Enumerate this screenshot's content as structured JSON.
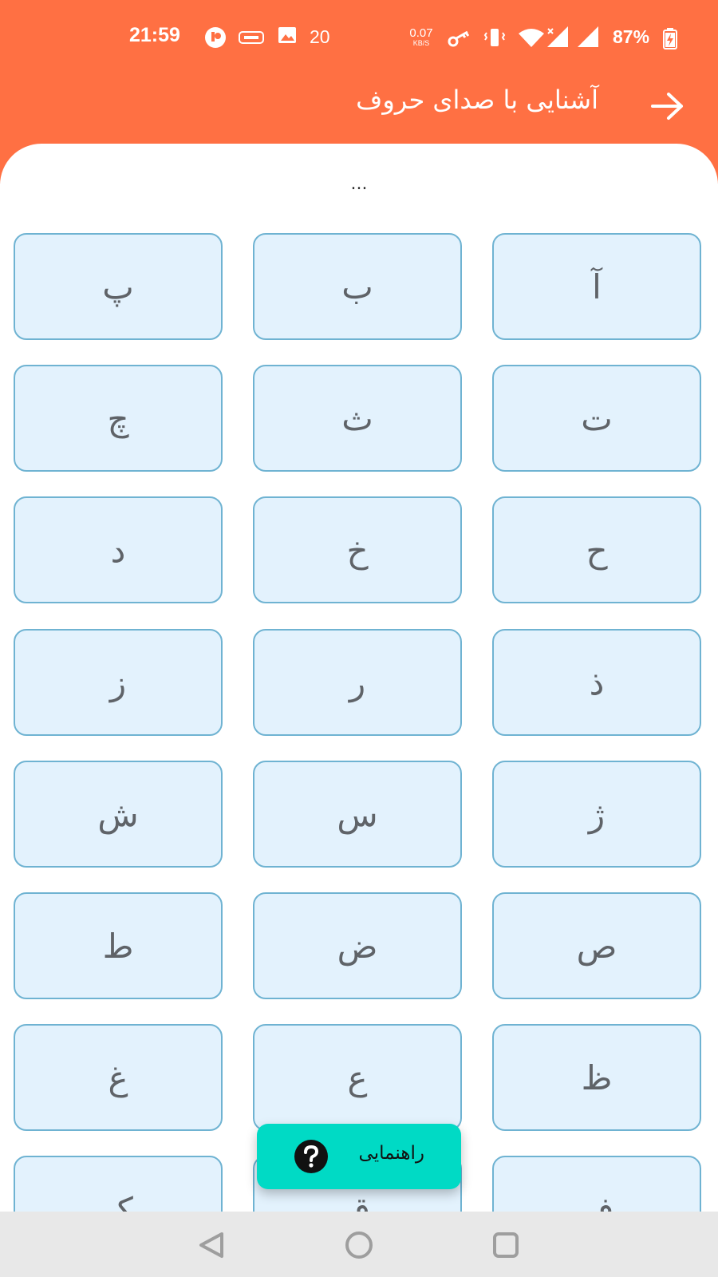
{
  "status_bar": {
    "time": "21:59",
    "notification_count": "20",
    "net_speed_value": "0.07",
    "net_speed_unit": "KB/S",
    "battery": "87%",
    "icons": [
      "circle-app-icon",
      "vpn-pill-icon",
      "image-icon",
      "key-icon",
      "vibrate-icon",
      "wifi-icon",
      "signal-no-data-icon",
      "signal-icon",
      "battery-charging-icon"
    ]
  },
  "header": {
    "title": "آشنایی با صدای حروف",
    "back_icon": "arrow-right-icon"
  },
  "status_message": "...",
  "letters": [
    "آ",
    "ب",
    "پ",
    "ت",
    "ث",
    "چ",
    "ح",
    "خ",
    "د",
    "ذ",
    "ر",
    "ز",
    "ژ",
    "س",
    "ش",
    "ص",
    "ض",
    "ط",
    "ظ",
    "ع",
    "غ",
    "ف",
    "ق",
    "ک"
  ],
  "help_button": {
    "label": "راهنمایی",
    "icon": "question-circle-icon"
  },
  "nav_bar": {
    "icons": [
      "back-triangle-icon",
      "home-circle-icon",
      "recents-square-icon"
    ]
  },
  "colors": {
    "header": "#ff7043",
    "tile_bg": "#e3f2fd",
    "tile_border": "#6fb3d2",
    "fab": "#00dac5"
  }
}
